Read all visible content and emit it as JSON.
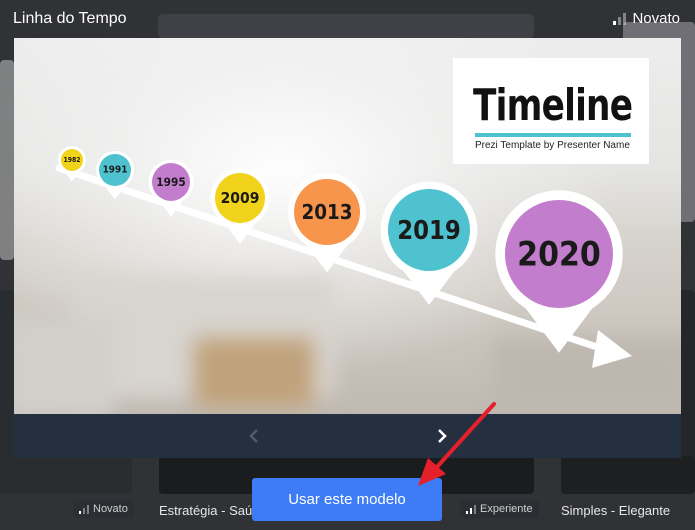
{
  "modal": {
    "title": "Linha do Tempo",
    "level": "Novato",
    "use_button": "Usar este modelo"
  },
  "slide": {
    "heading": "Timeline",
    "subheading": "Prezi Template by Presenter Name",
    "years": [
      "1982",
      "1991",
      "1995",
      "2009",
      "2013",
      "2019",
      "2020"
    ],
    "pin_colors": [
      "#f2d31c",
      "#4ec3cf",
      "#c37dcd",
      "#f2d31c",
      "#f6954b",
      "#4ec3cf",
      "#c37dcd"
    ]
  },
  "nav": {
    "prev_icon": "chevron-left-icon",
    "next_icon": "chevron-right-icon"
  },
  "gallery": {
    "cards": [
      {
        "label": "",
        "badge": "Novato"
      },
      {
        "label": "Estratégia - Saú",
        "badge": "Experiente"
      },
      {
        "label": "Simples - Elegante",
        "badge": ""
      }
    ]
  },
  "colors": {
    "accent": "#3d7cf5",
    "nav_bg": "#243040"
  }
}
